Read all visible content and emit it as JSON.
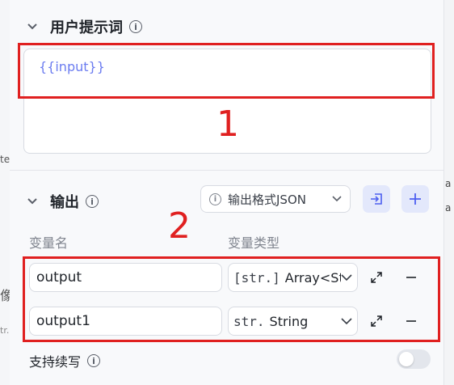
{
  "user_prompt": {
    "title": "用户提示词",
    "value": "{{input}}"
  },
  "output": {
    "title": "输出",
    "format_select": "输出格式JSON",
    "columns": {
      "name": "变量名",
      "type": "变量类型"
    },
    "rows": [
      {
        "name": "output",
        "type_icon": "[str.]",
        "type": "Array<St..."
      },
      {
        "name": "output1",
        "type_icon": "str.",
        "type": "String"
      }
    ]
  },
  "continue": {
    "label": "支持续写",
    "enabled": false
  },
  "annotations": {
    "one": "1",
    "two": "2"
  },
  "edge_fragments": {
    "left_1": "te",
    "left_2": "像",
    "left_3": "tr.",
    "right_1": "a",
    "right_2": "a"
  },
  "colors": {
    "accent": "#4d5ff0",
    "annotation": "#e02020",
    "placeholder_var": "#6b7cf0"
  }
}
